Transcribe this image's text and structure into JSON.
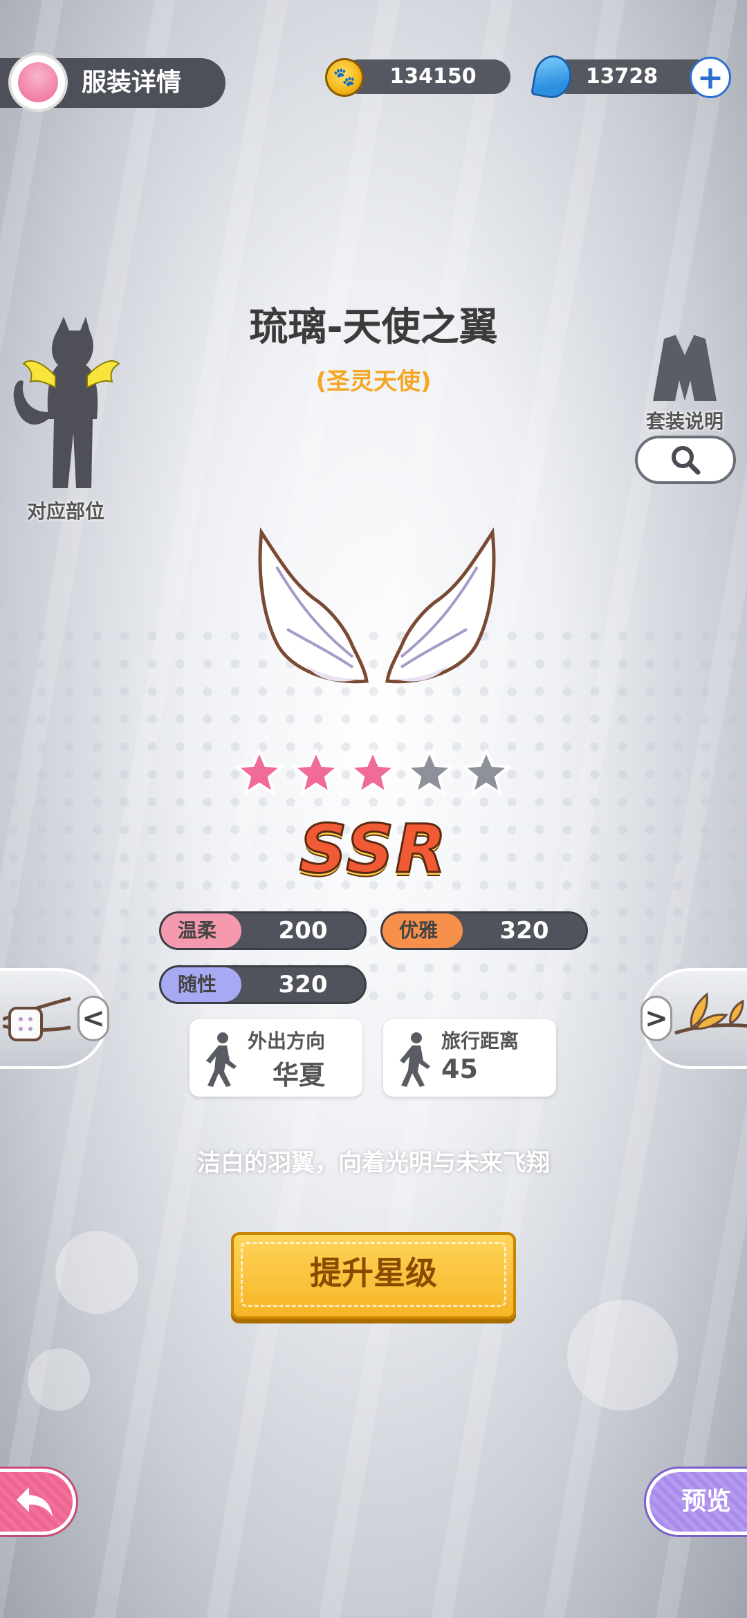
{
  "header": {
    "title": "服装详情",
    "coins": "134150",
    "gems": "13728",
    "plus": "+"
  },
  "item": {
    "name": "琉璃-天使之翼",
    "suit": "(圣灵天使)",
    "rarity": "SSR",
    "stars_filled": 3,
    "stars_total": 5,
    "description": "洁白的羽翼，向着光明与未来飞翔"
  },
  "left_panel": {
    "label": "对应部位"
  },
  "right_panel": {
    "label": "套装说明"
  },
  "attributes": [
    {
      "name": "温柔",
      "value": "200",
      "color": "#f59aae"
    },
    {
      "name": "优雅",
      "value": "320",
      "color": "#f7904a"
    },
    {
      "name": "随性",
      "value": "320",
      "color": "#a7a9f2"
    }
  ],
  "info": {
    "direction_label": "外出方向",
    "direction_value": "华夏",
    "distance_label": "旅行距离",
    "distance_value": "45"
  },
  "nav": {
    "prev": "<",
    "next": ">"
  },
  "buttons": {
    "upgrade": "提升星级",
    "preview": "预览"
  },
  "colors": {
    "suit_name": "#f5a623",
    "star_filled": "#f06a9a",
    "star_empty": "#8e9199",
    "upgrade": "#f6b526"
  }
}
